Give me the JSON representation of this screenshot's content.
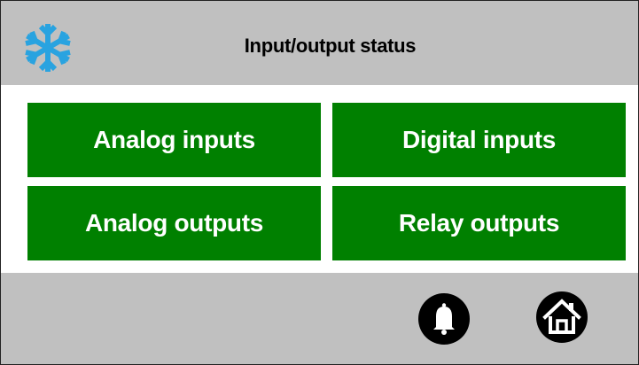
{
  "header": {
    "title": "Input/output status",
    "icon": "snowflake-icon",
    "icon_color": "#29a3e0"
  },
  "menu": {
    "analog_inputs": "Analog inputs",
    "digital_inputs": "Digital inputs",
    "analog_outputs": "Analog outputs",
    "relay_outputs": "Relay outputs",
    "button_color": "#008000"
  },
  "footer": {
    "icons": [
      "bell-icon",
      "home-icon"
    ]
  },
  "colors": {
    "panel": "#c0c0c0",
    "content": "#ffffff",
    "button_text": "#ffffff"
  }
}
